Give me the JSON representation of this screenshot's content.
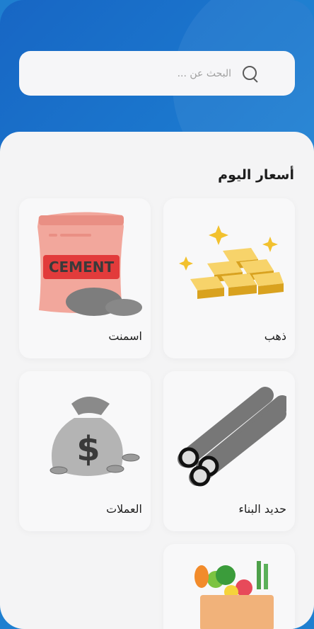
{
  "search": {
    "placeholder": "البحث عن ..."
  },
  "section": {
    "title": "أسعار اليوم"
  },
  "cards": [
    {
      "label": "ذهب",
      "icon": "gold-bars-icon"
    },
    {
      "label": "اسمنت",
      "icon": "cement-bag-icon"
    },
    {
      "label": "حديد البناء",
      "icon": "steel-rebar-icon"
    },
    {
      "label": "العملات",
      "icon": "money-bag-icon"
    },
    {
      "label": "",
      "icon": "vegetables-basket-icon"
    }
  ],
  "cement_bag": {
    "text": "CEMENT"
  },
  "money_bag": {
    "symbol": "$"
  }
}
